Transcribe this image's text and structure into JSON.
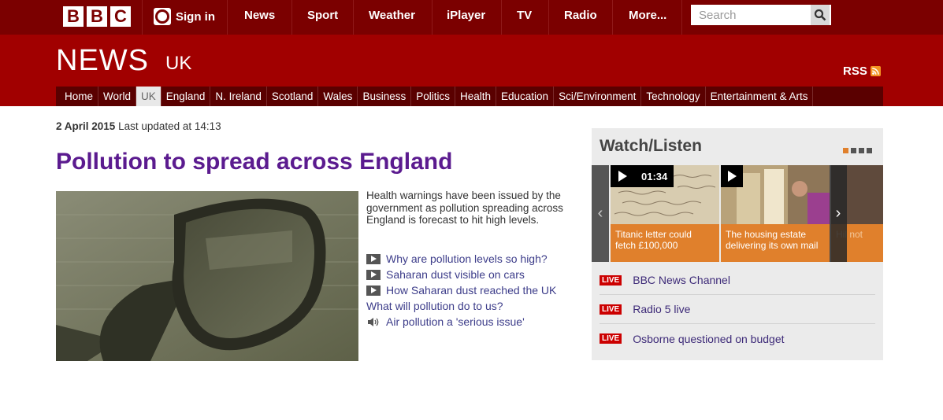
{
  "topbar": {
    "logo": [
      "B",
      "B",
      "C"
    ],
    "signin": "Sign in",
    "nav": [
      "News",
      "Sport",
      "Weather",
      "iPlayer",
      "TV",
      "Radio",
      "More..."
    ],
    "search_placeholder": "Search"
  },
  "header": {
    "title": "NEWS",
    "edition": "UK",
    "rss": "RSS"
  },
  "sections": [
    "Home",
    "World",
    "UK",
    "England",
    "N. Ireland",
    "Scotland",
    "Wales",
    "Business",
    "Politics",
    "Health",
    "Education",
    "Sci/Environment",
    "Technology",
    "Entertainment & Arts"
  ],
  "active_section": "UK",
  "story": {
    "date": "2 April 2015",
    "updated": "Last updated at 14:13",
    "headline": "Pollution to spread across England",
    "summary": "Health warnings have been issued by the government as pollution spreading across England is forecast to hit high levels.",
    "related": [
      {
        "label": "Why are pollution levels so high?",
        "icon": "video-icon"
      },
      {
        "label": "Saharan dust visible on cars",
        "icon": "video-icon"
      },
      {
        "label": "How Saharan dust reached the UK",
        "icon": "video-icon"
      },
      {
        "label": "What will pollution do to us?",
        "icon": ""
      },
      {
        "label": "Air pollution a 'serious issue'",
        "icon": "audio-icon"
      }
    ]
  },
  "watch": {
    "title": "Watch/Listen",
    "cards": [
      {
        "caption": "Titanic letter could fetch £100,000",
        "duration": "01:34"
      },
      {
        "caption": "The housing estate delivering its own mail",
        "duration": ""
      },
      {
        "caption": "Hil not",
        "duration": ""
      }
    ],
    "live_badge": "LIVE",
    "live": [
      "BBC News Channel",
      "Radio 5 live",
      "Osborne questioned on budget"
    ]
  },
  "colors": {
    "topbar": "#7b0000",
    "header": "#a10000",
    "headline": "#5b1b8f",
    "accent": "#e0802c"
  }
}
